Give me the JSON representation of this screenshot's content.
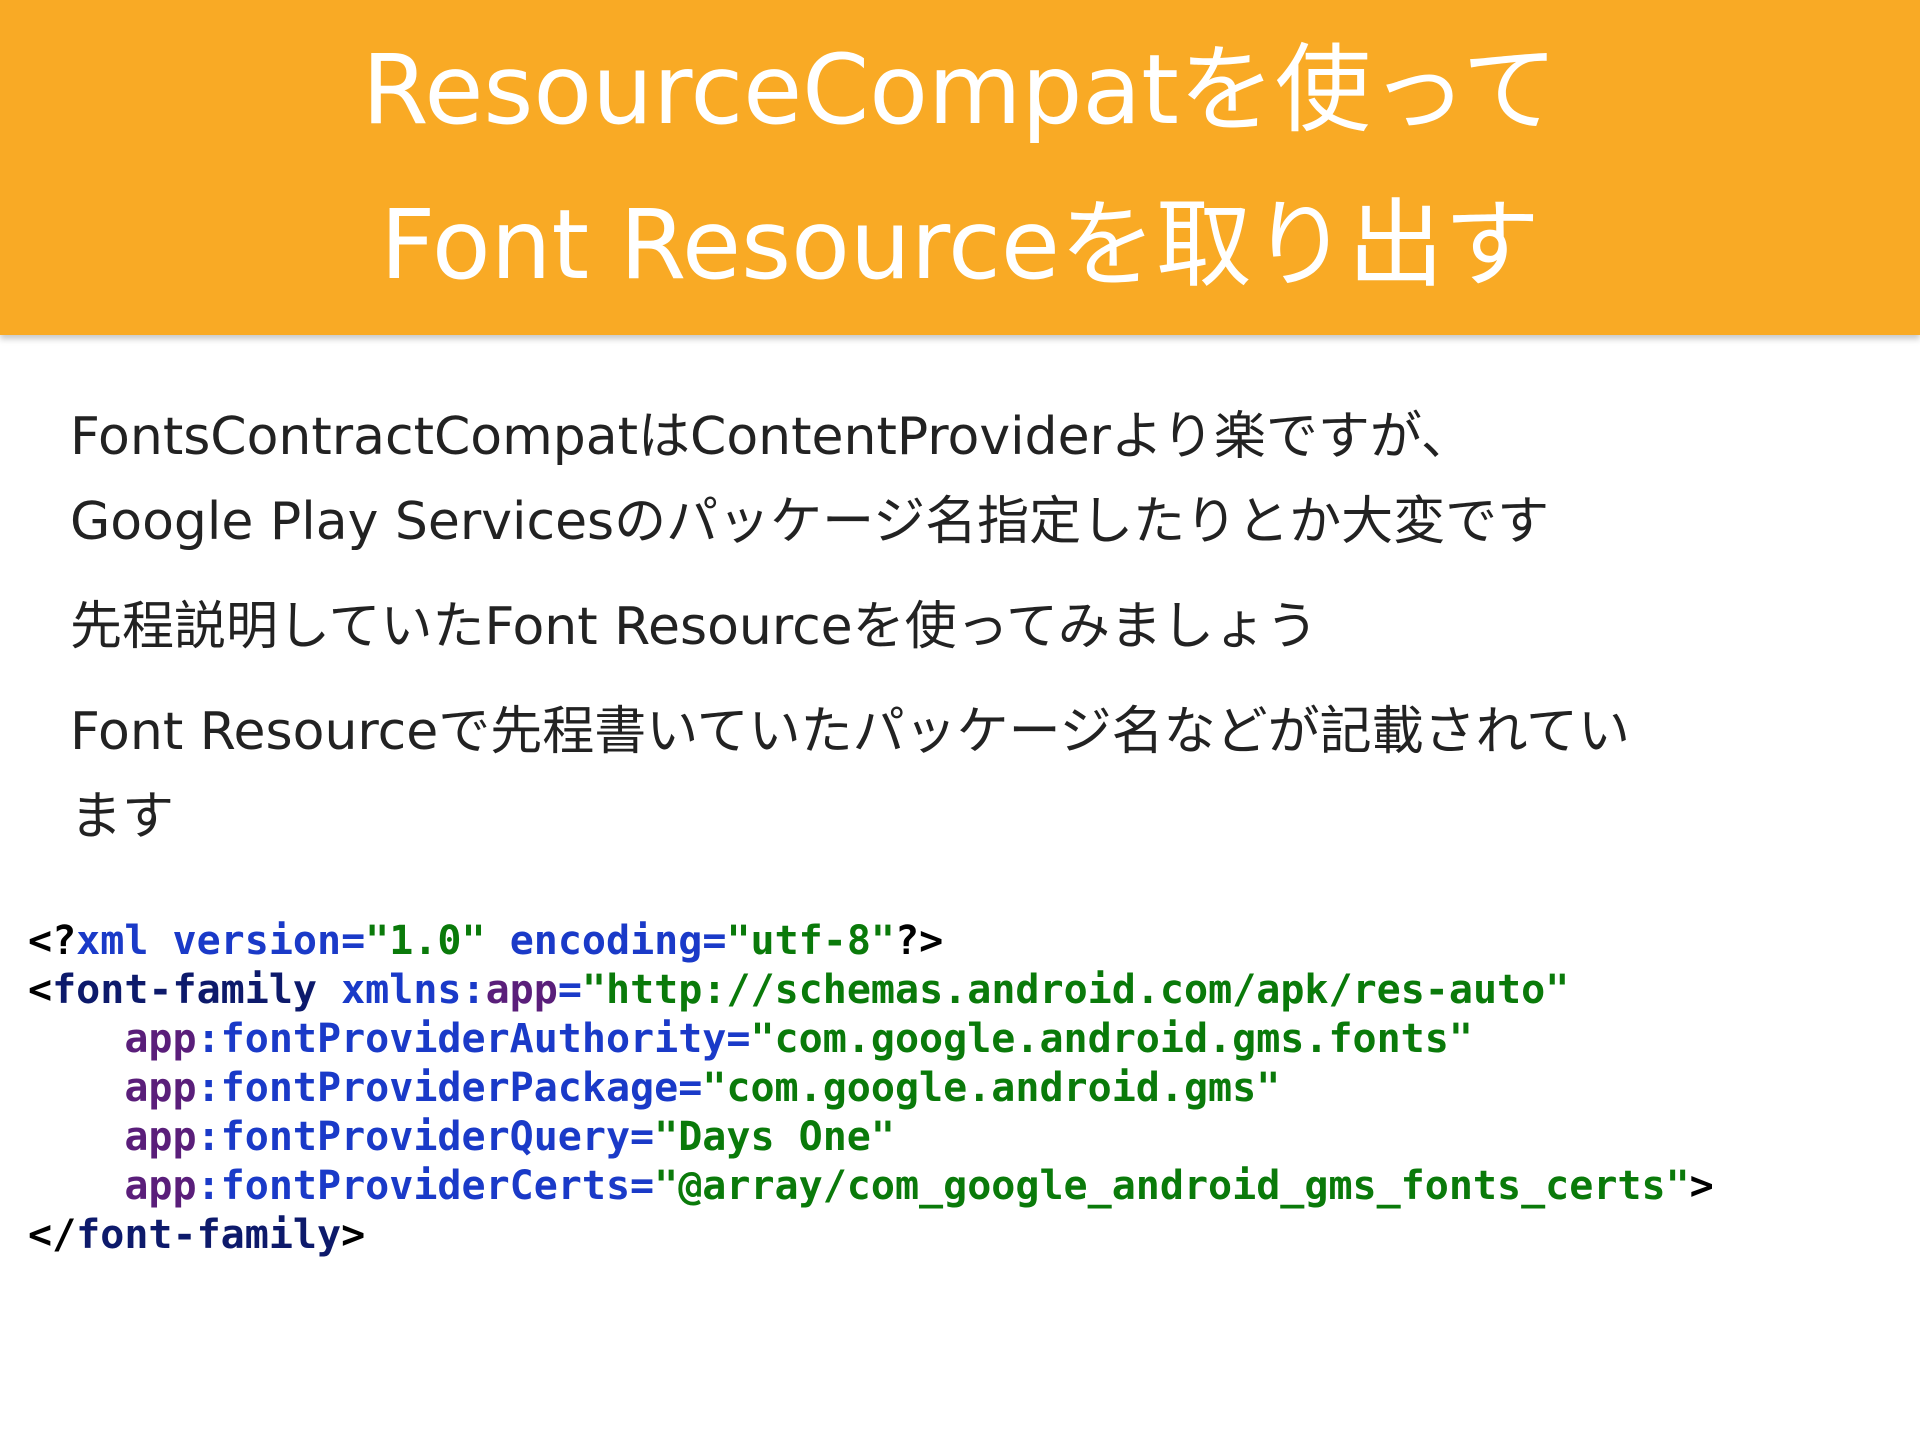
{
  "title": {
    "line1": "ResourceCompatを使って",
    "line2": "Font Resourceを取り出す"
  },
  "body": {
    "paragraph1_line1": "FontsContractCompatはContentProviderより楽ですが、",
    "paragraph1_line2": "Google Play Servicesのパッケージ名指定したりとか大変です",
    "paragraph2": "先程説明していたFont Resourceを使ってみましょう",
    "paragraph3_line1": "Font Resourceで先程書いていたパッケージ名などが記載されてい",
    "paragraph3_line2": "ます"
  },
  "code": {
    "line1": {
      "open": "<?",
      "xml": "xml",
      "sp1": " ",
      "version_attr": "version=",
      "version_val": "\"1.0\"",
      "sp2": " ",
      "encoding_attr": "encoding=",
      "encoding_val": "\"utf-8\"",
      "close": "?>"
    },
    "line2": {
      "open": "<",
      "tag": "font-family",
      "sp": " ",
      "xmlns": "xmlns:",
      "ns": "app",
      "eq": "=",
      "val": "\"http://schemas.android.com/apk/res-auto\""
    },
    "line3": {
      "indent": "    ",
      "ns": "app",
      "attr": ":fontProviderAuthority=",
      "val": "\"com.google.android.gms.fonts\""
    },
    "line4": {
      "indent": "    ",
      "ns": "app",
      "attr": ":fontProviderPackage=",
      "val": "\"com.google.android.gms\""
    },
    "line5": {
      "indent": "    ",
      "ns": "app",
      "attr": ":fontProviderQuery=",
      "val": "\"Days One\""
    },
    "line6": {
      "indent": "    ",
      "ns": "app",
      "attr": ":fontProviderCerts=",
      "val": "\"@array/com_google_android_gms_fonts_certs\"",
      "close": ">"
    },
    "line7": {
      "open": "</",
      "tag": "font-family",
      "close": ">"
    }
  },
  "colors": {
    "header_background": "#f9aa25",
    "title_text": "#ffffff",
    "body_text": "#222222",
    "code_keyword": "#1a3ac8",
    "code_string": "#0a7a0a",
    "code_tag": "#0d1a6b",
    "code_namespace": "#5a1e7a"
  }
}
